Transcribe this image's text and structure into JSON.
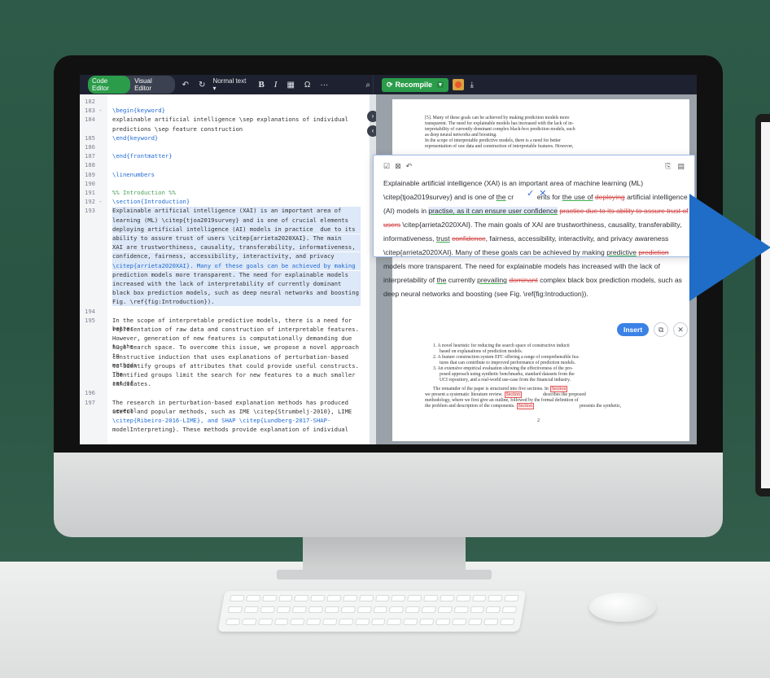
{
  "toolbar": {
    "code_editor": "Code Editor",
    "visual_editor": "Visual Editor",
    "undo_icon": "↶",
    "redo_icon": "↻",
    "text_style": "Normal text",
    "bold": "B",
    "italic": "I",
    "omega": "Ω",
    "more": "···",
    "search_icon": "⌕",
    "recompile": "Recompile",
    "download_icon": "⤓"
  },
  "editor": {
    "lines": [
      {
        "n": "182",
        "t": ""
      },
      {
        "n": "183 -",
        "t": "\\begin{keyword}"
      },
      {
        "n": "184",
        "t": "explainable artificial intelligence \\sep explanations of individual"
      },
      {
        "n": "",
        "t": "predictions \\sep feature construction"
      },
      {
        "n": "185",
        "t": "\\end{keyword}"
      },
      {
        "n": "186",
        "t": ""
      },
      {
        "n": "187",
        "t": "\\end{frontmatter}"
      },
      {
        "n": "188",
        "t": ""
      },
      {
        "n": "189",
        "t": "\\linenumbers"
      },
      {
        "n": "190",
        "t": ""
      },
      {
        "n": "191",
        "t": "%% Introduction %%"
      },
      {
        "n": "192 -",
        "t": "\\section{Introduction}"
      },
      {
        "n": "193",
        "t": "Explainable artificial intelligence (XAI) is an important area of machine"
      },
      {
        "n": "",
        "t": "learning (ML) \\citep{tjoa2019survey} and is one of crucial elements for"
      },
      {
        "n": "",
        "t": "deploying artificial intelligence (AI) models in practice  due to its"
      },
      {
        "n": "",
        "t": "ability to assure trust of users \\citep{arrieta2020XAI}. The main goals of"
      },
      {
        "n": "",
        "t": "XAI are trustworthiness, causality, transferability, informativeness,"
      },
      {
        "n": "",
        "t": "confidence, fairness, accessibility, interactivity, and privacy awareness"
      },
      {
        "n": "",
        "t": "\\citep{arrieta2020XAI}. Many of these goals can be achieved by making"
      },
      {
        "n": "",
        "t": "prediction models more transparent. The need for explainable models has"
      },
      {
        "n": "",
        "t": "increased with the lack of interpretability of currently dominant complex"
      },
      {
        "n": "",
        "t": "black box prediction models, such as deep neural networks and boosting (see"
      },
      {
        "n": "",
        "t": "Fig. \\ref{fig:Introduction})."
      },
      {
        "n": "194",
        "t": ""
      },
      {
        "n": "195",
        "t": "In the scope of interpretable predictive models, there is a need for better"
      },
      {
        "n": "",
        "t": "representation of raw data and construction of interpretable features."
      },
      {
        "n": "",
        "t": "However, generation of new features is computationally demanding due to the"
      },
      {
        "n": "",
        "t": "huge search space. To overcome this issue, we propose a novel approach to"
      },
      {
        "n": "",
        "t": "constructive induction that uses explanations of perturbation-based methods"
      },
      {
        "n": "",
        "t": "to identify groups of attributes that could provide useful constructs. The"
      },
      {
        "n": "",
        "t": "identified groups limit the search for new features to a much smaller set of"
      },
      {
        "n": "",
        "t": "candidates."
      },
      {
        "n": "196",
        "t": ""
      },
      {
        "n": "197",
        "t": "The research in perturbation-based explanation methods has produced several"
      },
      {
        "n": "",
        "t": "useful and popular methods, such as IME \\citep{Strumbelj-2010}, LIME"
      },
      {
        "n": "",
        "t": "\\citep{Ribeiro-2016-LIME}, and SHAP \\citep{Lundberg-2017-SHAP-"
      },
      {
        "n": "",
        "t": "modelInterpreting}. These methods provide explanation of individual"
      }
    ]
  },
  "pdf": {
    "top_para": [
      "[5]. Many of these goals can be achieved by making prediction models more",
      "transparent. The need for explainable models has increased with the lack of in-",
      "terpretability of currently dominant complex black-box prediction models, such",
      "as deep neural networks and boosting.",
      "In the scope of interpretable predictive models, there is a need for better",
      "representation of raw data and construction of interpretable features. However,"
    ],
    "list": [
      "1. A novel heuristic for reducing the search space of constructive inducti",
      "based on explanations of prediction models.",
      "2. A feature construction system EFC offering a range of comprehensible fea-",
      "tures that can contribute to improved performance of prediction models.",
      "3. An extensive empirical evaluation showing the effectiveness of the pro-",
      "posed approach using synthetic benchmarks, standard datasets from the",
      "UCI repository, and a real-world use-case from the financial industry."
    ],
    "bottom_para": [
      "The remainder of the paper is structured into five sections. In",
      "we present a systematic literature review.",
      "describes the proposed",
      "methodology, where we first give an outline, followed by the formal definition of",
      "the problem and description of the components.",
      "presents the synthetic,"
    ],
    "section_ref": "Section",
    "page_number": "2"
  },
  "popup": {
    "icons_left": [
      "☑",
      "⊠",
      "↶"
    ],
    "icons_right": [
      "⎘",
      "▤"
    ],
    "accept_icon": "✓",
    "reject_icon": "✕",
    "insert": "Insert",
    "copy_icon": "⧉",
    "close_icon": "✕"
  }
}
